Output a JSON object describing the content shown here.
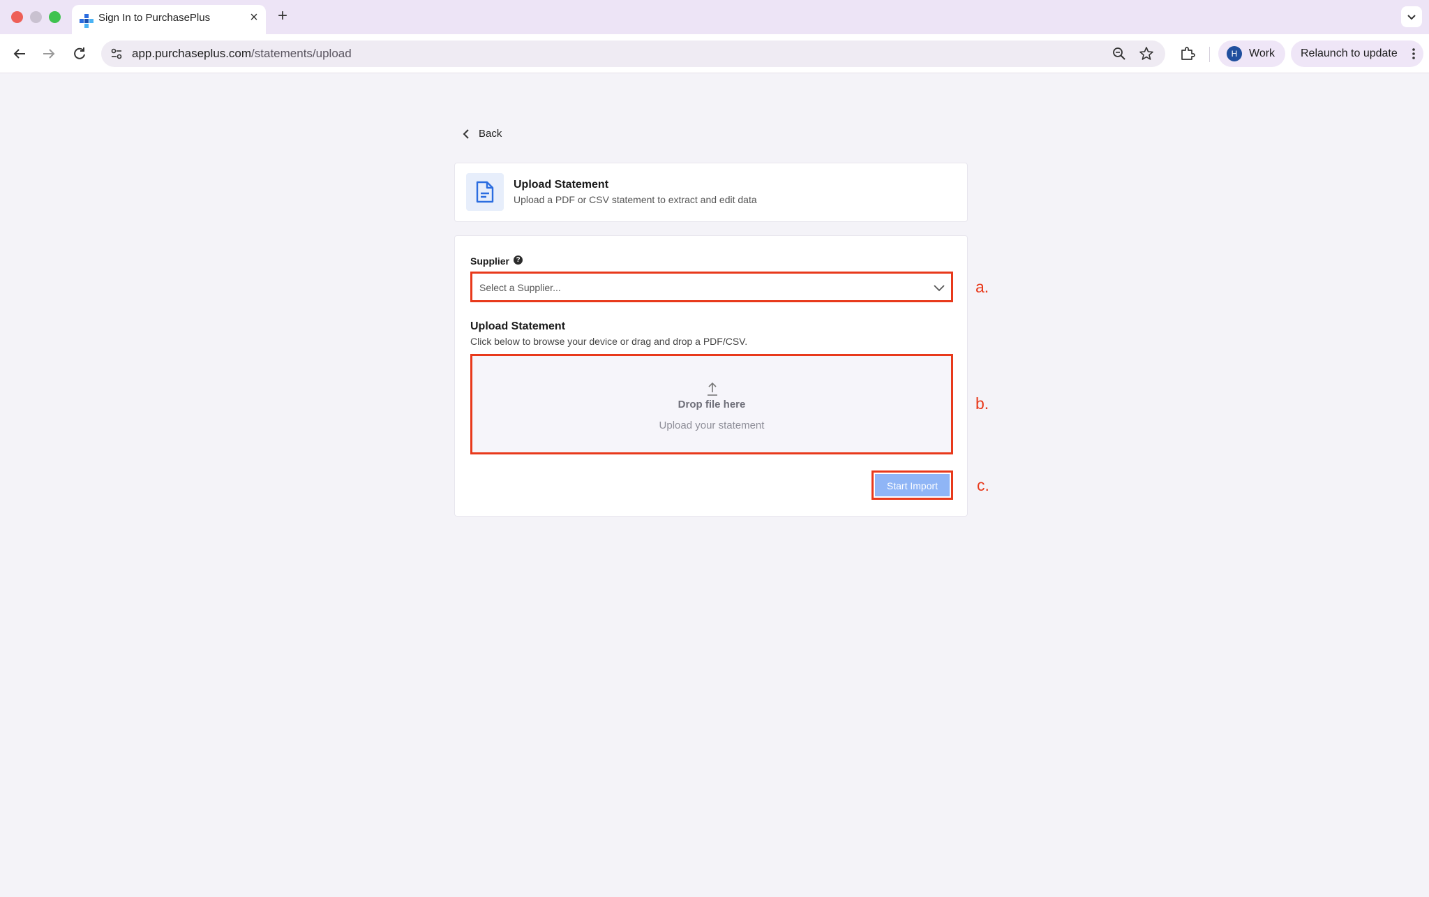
{
  "browser": {
    "tab_title": "Sign In to PurchasePlus",
    "tab_close": "×",
    "new_tab": "+",
    "url_host": "app.purchaseplus.com",
    "url_path": "/statements/upload",
    "profile_initial": "H",
    "profile_name": "Work",
    "relaunch_label": "Relaunch to update"
  },
  "page": {
    "back_label": "Back",
    "header": {
      "title": "Upload Statement",
      "subtitle": "Upload a PDF or CSV statement to extract and edit data"
    },
    "form": {
      "supplier_label": "Supplier",
      "help_glyph": "?",
      "supplier_placeholder": "Select a Supplier...",
      "upload_title": "Upload Statement",
      "upload_subtitle": "Click below to browse your device or drag and drop a PDF/CSV.",
      "dropzone_title": "Drop file here",
      "dropzone_subtitle": "Upload your statement",
      "start_import_label": "Start Import"
    }
  },
  "annotations": {
    "a": "a.",
    "b": "b.",
    "c": "c."
  },
  "colors": {
    "highlight": "#e8391b",
    "primary_disabled": "#8fb5f6",
    "doc_icon": "#2b6de0"
  }
}
